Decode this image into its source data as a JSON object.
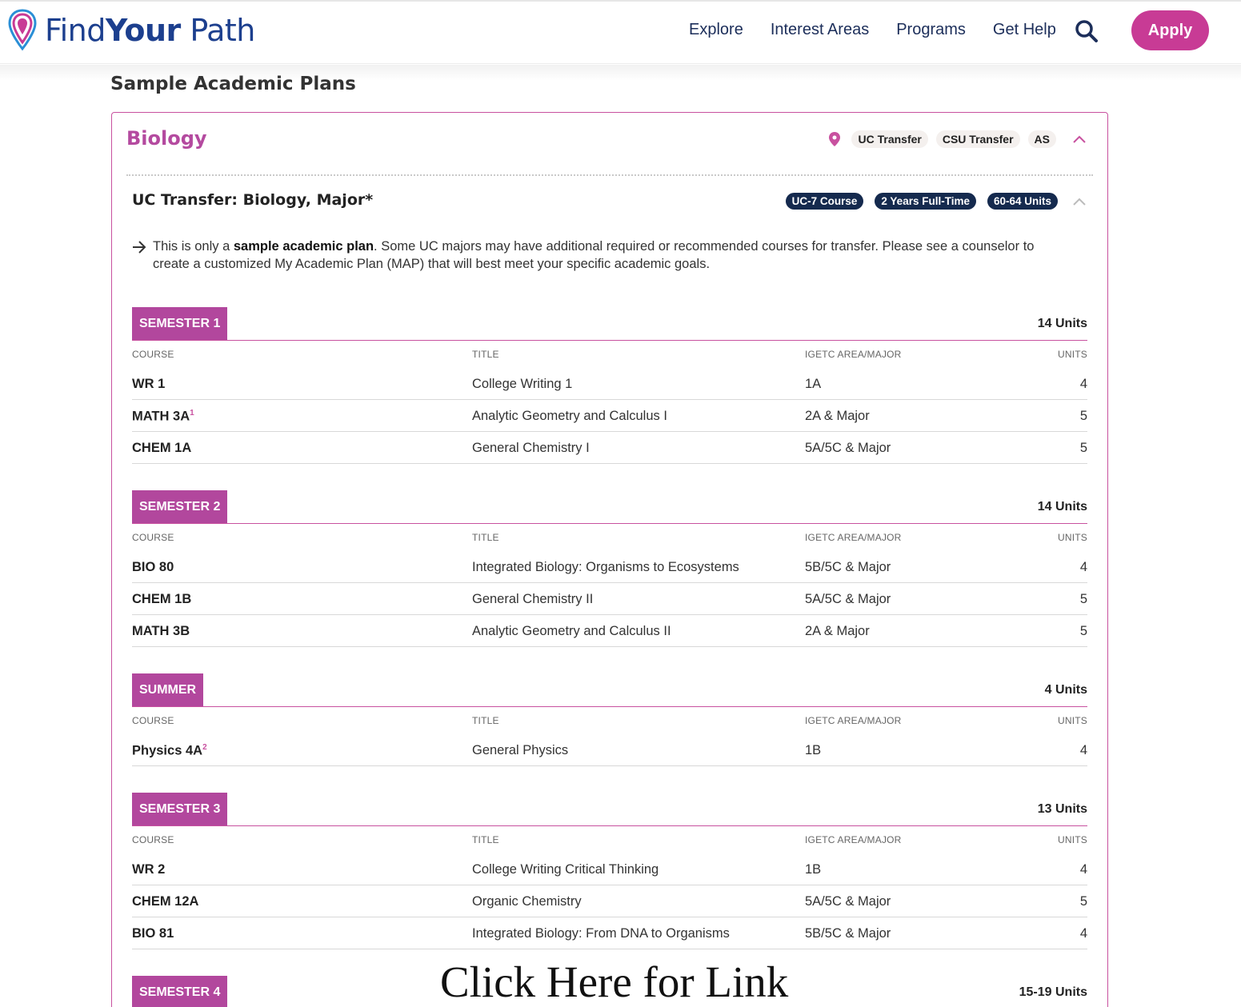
{
  "header": {
    "logo": {
      "find": "Find",
      "your": "Your",
      "path": "Path"
    },
    "nav": [
      "Explore",
      "Interest Areas",
      "Programs",
      "Get Help"
    ],
    "apply_label": "Apply"
  },
  "page": {
    "section_title": "Sample Academic Plans"
  },
  "plan": {
    "name": "Biology",
    "tags": [
      "UC Transfer",
      "CSU Transfer",
      "AS"
    ],
    "path_title": "UC Transfer: Biology, Major*",
    "path_pills": [
      "UC-7 Course",
      "2 Years Full-Time",
      "60-64 Units"
    ],
    "note_pre": "This is only a ",
    "note_bold": "sample academic plan",
    "note_post": ". Some UC majors may have additional required or recommended courses for transfer. Please see a counselor to create a customized My Academic Plan (MAP) that will best meet your specific academic goals."
  },
  "columns": [
    "COURSE",
    "TITLE",
    "IGETC AREA/MAJOR",
    "UNITS"
  ],
  "semesters": [
    {
      "label": "SEMESTER 1",
      "units": "14 Units",
      "rows": [
        {
          "course": "WR 1",
          "sup": "",
          "title": "College Writing 1",
          "area": "1A",
          "units": "4"
        },
        {
          "course": "MATH 3A",
          "sup": "1",
          "title": "Analytic Geometry and Calculus I",
          "area": "2A & Major",
          "units": "5"
        },
        {
          "course": "CHEM 1A",
          "sup": "",
          "title": "General Chemistry I",
          "area": "5A/5C & Major",
          "units": "5"
        }
      ]
    },
    {
      "label": "SEMESTER 2",
      "units": "14 Units",
      "rows": [
        {
          "course": "BIO 80",
          "sup": "",
          "title": "Integrated Biology: Organisms to Ecosystems",
          "area": "5B/5C & Major",
          "units": "4"
        },
        {
          "course": "CHEM 1B",
          "sup": "",
          "title": "General Chemistry II",
          "area": "5A/5C & Major",
          "units": "5"
        },
        {
          "course": "MATH 3B",
          "sup": "",
          "title": "Analytic Geometry and Calculus II",
          "area": "2A & Major",
          "units": "5"
        }
      ]
    },
    {
      "label": "SUMMER",
      "units": "4 Units",
      "rows": [
        {
          "course": "Physics 4A",
          "sup": "2",
          "title": "General Physics",
          "area": "1B",
          "units": "4"
        }
      ]
    },
    {
      "label": "SEMESTER 3",
      "units": "13 Units",
      "rows": [
        {
          "course": "WR 2",
          "sup": "",
          "title": "College Writing Critical Thinking",
          "area": "1B",
          "units": "4"
        },
        {
          "course": "CHEM 12A",
          "sup": "",
          "title": "Organic Chemistry",
          "area": "5A/5C & Major",
          "units": "5"
        },
        {
          "course": "BIO 81",
          "sup": "",
          "title": "Integrated Biology: From DNA to Organisms",
          "area": "5B/5C & Major",
          "units": "4"
        }
      ]
    },
    {
      "label": "SEMESTER 4",
      "units": "15-19 Units",
      "rows": []
    }
  ],
  "overlay_text": "Click Here for Link",
  "colors": {
    "brand_blue": "#1c3f8e",
    "accent_magenta": "#b2479d",
    "apply_pink": "#c83b95",
    "pill_navy": "#152a4e"
  },
  "icons": [
    "map-pin-logo-icon",
    "search-icon",
    "map-pin-icon",
    "chevron-up-icon",
    "arrow-right-icon"
  ]
}
